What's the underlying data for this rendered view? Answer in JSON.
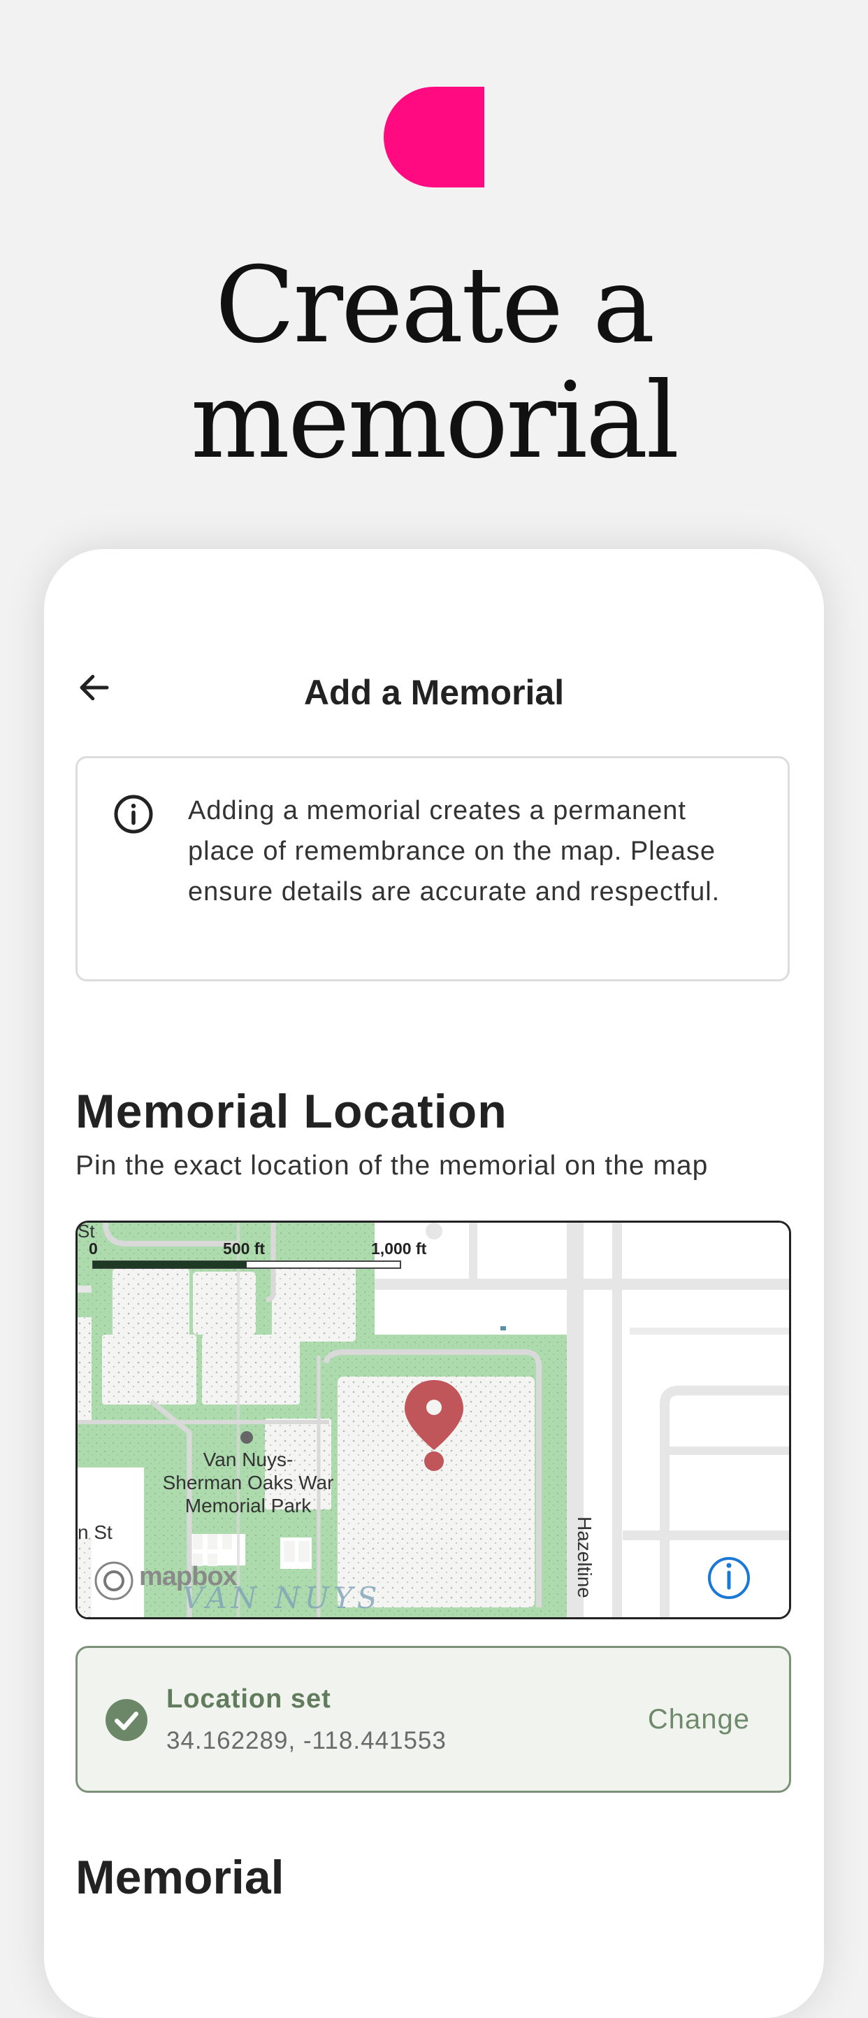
{
  "hero": {
    "title_line1": "Create a",
    "title_line2": "memorial"
  },
  "colors": {
    "brand": "#ff0a80",
    "pin": "#c0555a",
    "success": "#6b8767",
    "map_green": "#aedbad",
    "info_blue": "#1a78d6"
  },
  "header": {
    "back_icon": "arrow-left-icon",
    "title": "Add a Memorial"
  },
  "notice": {
    "icon": "info-icon",
    "text": "Adding a memorial creates a permanent place of remembrance on the map. Please ensure details are accurate and respectful."
  },
  "location": {
    "title": "Memorial Location",
    "subtitle": "Pin the exact location of the memorial on the map"
  },
  "map": {
    "scale": {
      "tick0": "0",
      "tick1": "500 ft",
      "tick2": "1,000 ft"
    },
    "labels": {
      "park": "Van Nuys-\nSherman Oaks War\nMemorial Park",
      "street_top": "St",
      "street_left": "n St",
      "street_right": "Hazeltine",
      "district": "VAN NUYS"
    },
    "attribution": "mapbox",
    "pin_icon": "map-pin-icon",
    "attribution_icon": "info-circle-icon"
  },
  "status": {
    "icon": "check-circle-icon",
    "title": "Location set",
    "coords": "34.162289, -118.441553",
    "change_label": "Change"
  },
  "next_section": {
    "title": "Memorial"
  }
}
